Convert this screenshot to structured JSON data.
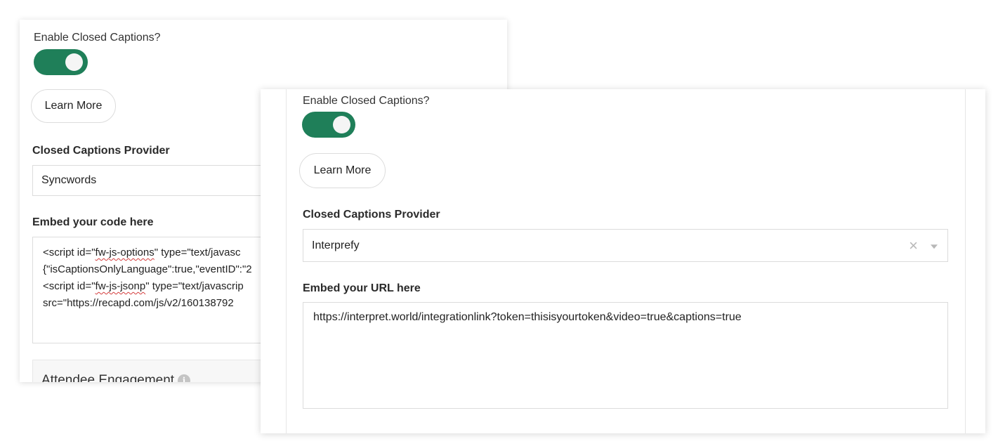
{
  "back_panel": {
    "enable_label": "Enable Closed Captions?",
    "toggle_on": true,
    "learn_more_label": "Learn More",
    "provider_label": "Closed Captions Provider",
    "provider_value": "Syncwords",
    "embed_label": "Embed your code here",
    "code_lines": [
      {
        "pre": "<script id=\"",
        "sq": "fw-js-options",
        "post": "\" type=\"text/javasc"
      },
      {
        "pre": "{\"isCaptionsOnlyLanguage\":true,\"eventID\":\"2",
        "sq": "",
        "post": ""
      },
      {
        "pre": "<script id=\"",
        "sq": "fw-js-jsonp",
        "post": "\" type=\"text/javascrip"
      },
      {
        "pre": "src=\"https://recapd.com/js/v2/160138792",
        "sq": "",
        "post": ""
      }
    ],
    "section_title": "Attendee Engagement",
    "info_glyph": "i"
  },
  "front_panel": {
    "enable_label": "Enable Closed Captions?",
    "toggle_on": true,
    "learn_more_label": "Learn More",
    "provider_label": "Closed Captions Provider",
    "provider_value": "Interprefy",
    "clear_glyph": "×",
    "embed_label": "Embed your URL here",
    "url_value": "https://interpret.world/integrationlink?token=thisisyourtoken&video=true&captions=true"
  },
  "colors": {
    "toggle_accent": "#1f7f59",
    "border": "#dcdcdc",
    "spellcheck": "#d43c3c"
  }
}
